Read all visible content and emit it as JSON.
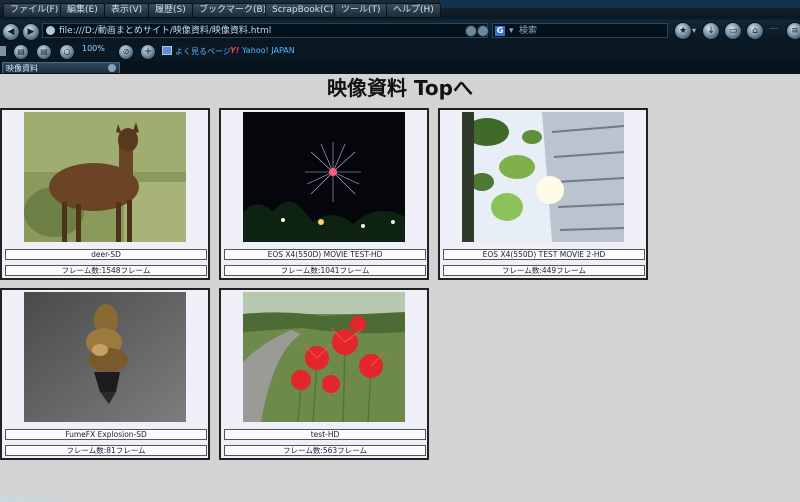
{
  "menu": [
    "ファイル(F)",
    "編集(E)",
    "表示(V)",
    "履歴(S)",
    "ブックマーク(B)",
    "ScrapBook(C)",
    "ツール(T)",
    "ヘルプ(H)"
  ],
  "address": {
    "url": "file:///D:/動画まとめサイト/映像資料/映像資料.html"
  },
  "search": {
    "engine": "G",
    "placeholder": "検索"
  },
  "toolbar": {
    "zoom": "100%"
  },
  "bookmarks": {
    "frequent": "よく見るページ",
    "yahoo_prefix": "Y!",
    "yahoo": "Yahoo! JAPAN"
  },
  "tab": {
    "title": "映像資料"
  },
  "page": {
    "title": "映像資料 Topへ"
  },
  "videos": [
    {
      "name": "deer-SD",
      "frames": "フレーム数:1548フレーム",
      "thumb": "deer"
    },
    {
      "name": "EOS X4(550D) MOVIE TEST-HD",
      "frames": "フレーム数:1041フレーム",
      "thumb": "fireworks"
    },
    {
      "name": "EOS X4(550D) TEST MOVIE 2-HD",
      "frames": "フレーム数:449フレーム",
      "thumb": "leaves-building"
    },
    {
      "name": "FumeFX Explosion-SD",
      "frames": "フレーム数:81フレーム",
      "thumb": "explosion"
    },
    {
      "name": "test-HD",
      "frames": "フレーム数:563フレーム",
      "thumb": "red-flowers"
    }
  ],
  "colors": {
    "chrome": "#0c1d2b",
    "page_bg": "#d3d3d3",
    "card_bg": "#efeff7",
    "link_blue": "#4fb8ff",
    "yahoo_red": "#ff3b3b"
  }
}
